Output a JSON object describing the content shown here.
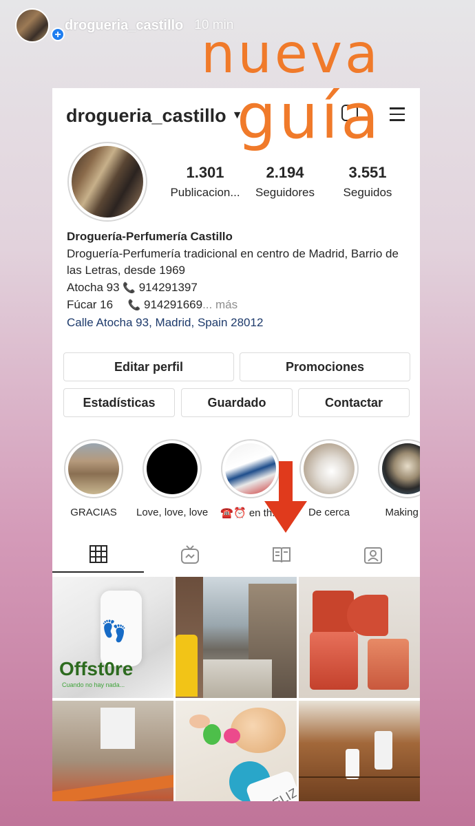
{
  "story": {
    "username": "drogueria_castillo",
    "time": "10 min"
  },
  "overlay": {
    "line1": "nueva",
    "line2": "guía"
  },
  "profile": {
    "username": "drogueria_castillo",
    "stats": [
      {
        "value": "1.301",
        "label": "Publicacion..."
      },
      {
        "value": "2.194",
        "label": "Seguidores"
      },
      {
        "value": "3.551",
        "label": "Seguidos"
      }
    ],
    "bio": {
      "name": "Droguería-Perfumería Castillo",
      "line1": "Droguería-Perfumería tradicional en centro de Madrid, Barrio de las Letras, desde 1969",
      "line2_prefix": "Atocha 93",
      "line2_phone": "914291397",
      "line3_prefix": "Fúcar 16",
      "line3_phone": "914291669",
      "more": "... más",
      "location": "Calle Atocha 93, Madrid, Spain 28012"
    },
    "buttons": {
      "edit": "Editar perfil",
      "promotions": "Promociones",
      "stats": "Estadísticas",
      "saved": "Guardado",
      "contact": "Contactar"
    },
    "highlights": [
      {
        "label": "GRACIAS"
      },
      {
        "label": "Love, love, love"
      },
      {
        "label": "☎️⏰ en th..."
      },
      {
        "label": "De cerca"
      },
      {
        "label": "Making of"
      }
    ],
    "tabs": [
      "grid-icon",
      "igtv-icon",
      "guides-icon",
      "tagged-icon"
    ],
    "grid": [
      {
        "caption": "Offst0re",
        "sub": "Cuando no hay nada..."
      },
      {
        "caption": ""
      },
      {
        "caption": ""
      },
      {
        "caption": ""
      },
      {
        "caption": ""
      },
      {
        "caption": "FELIZ"
      }
    ]
  },
  "colors": {
    "overlay": "#f07a2a",
    "arrow": "#e03a1c",
    "link": "#1d3a6b"
  }
}
